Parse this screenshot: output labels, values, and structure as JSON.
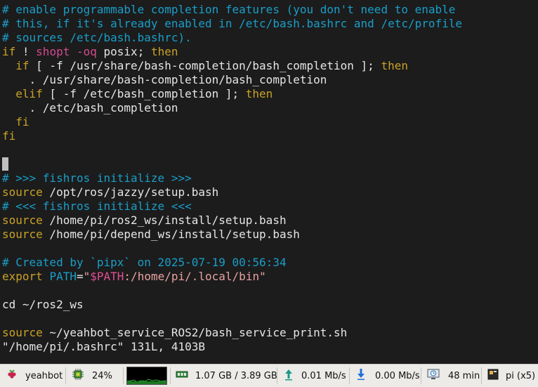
{
  "terminal": {
    "lines": [
      [
        "# enable programmable completion features (you don't need to enable"
      ],
      [
        "# this, if it's already enabled in /etc/bash.bashrc and /etc/profile"
      ],
      [
        "# sources /etc/bash.bashrc)."
      ],
      [
        "if",
        " ! ",
        "shopt",
        " ",
        "-oq",
        " posix; ",
        "then"
      ],
      [
        "  ",
        "if",
        " [ -f /usr/share/bash-completion/bash_completion ]; ",
        "then"
      ],
      [
        "    . /usr/share/bash-completion/bash_completion"
      ],
      [
        "  ",
        "elif",
        " [ -f /etc/bash_completion ]; ",
        "then"
      ],
      [
        "    . /etc/bash_completion"
      ],
      [
        "  fi"
      ],
      [
        "fi"
      ],
      [
        "# >>> fishros initialize >>>"
      ],
      [
        "source",
        " /opt/ros/jazzy/setup.bash"
      ],
      [
        "# <<< fishros initialize <<<"
      ],
      [
        "source",
        " /home/pi/ros2_ws/install/setup.bash"
      ],
      [
        "source",
        " /home/pi/depend_ws/install/setup.bash"
      ],
      [
        "# Created by `pipx` on 2025-07-19 00:56:34"
      ],
      [
        "export",
        " ",
        "PATH",
        "=",
        "\"",
        "$PATH",
        ":/home/pi/.local/bin\""
      ],
      [
        "cd ~/ros2_ws"
      ],
      [
        "source",
        " ~/yeahbot_service_ROS2/bash_service_print.sh"
      ],
      [
        "\"/home/pi/.bashrc\" 131L, 4103B"
      ]
    ]
  },
  "taskbar": {
    "hostname": "yeahbot",
    "cpu_percent": "24%",
    "memory": "1.07 GB / 3.89 GB",
    "upload": "0.01 Mb/s",
    "download": "0.00 Mb/s",
    "uptime": "48 min",
    "windows": "pi (x5)",
    "icons": [
      "raspberry-icon",
      "cpu-chip-icon",
      "memory-icon",
      "upload-arrow-icon",
      "download-arrow-icon",
      "monitor-clock-icon",
      "terminal-window-icon"
    ],
    "colors": {
      "comment": "#1a9ec9",
      "keyword": "#c9a227",
      "flag": "#d24b8f",
      "string": "#e8a1a1"
    }
  }
}
